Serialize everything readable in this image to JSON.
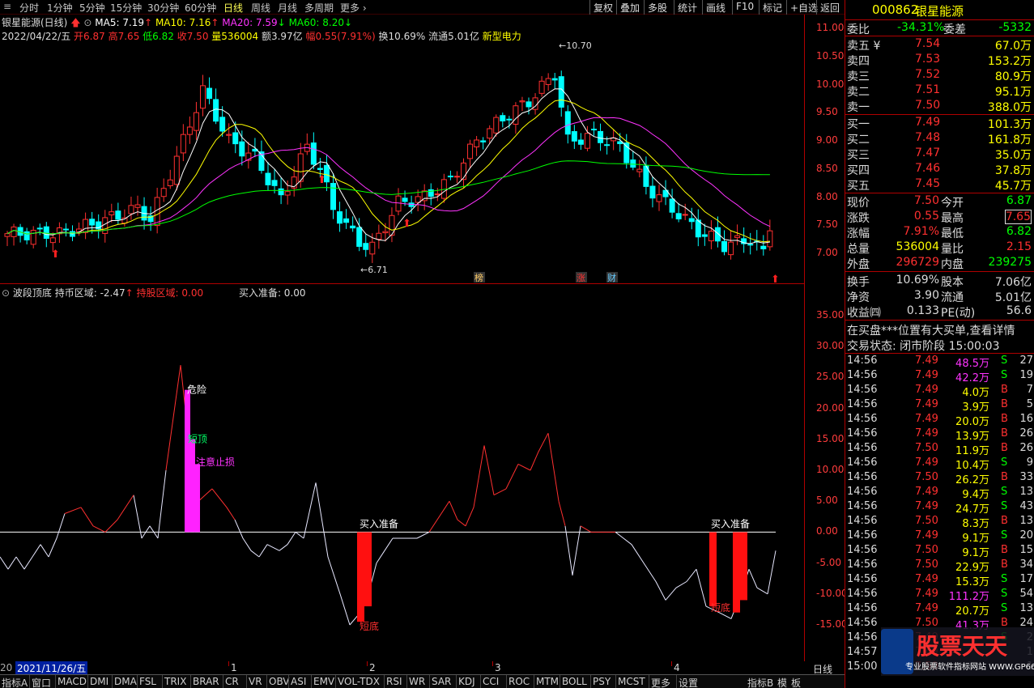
{
  "topbar": {
    "periods": [
      "分时",
      "1分钟",
      "5分钟",
      "15分钟",
      "30分钟",
      "60分钟",
      "日线",
      "周线",
      "月线",
      "多周期",
      "更多 ›"
    ],
    "active_period": "日线",
    "right_buttons": [
      "复权",
      "叠加",
      "多股",
      "统计",
      "画线",
      "F10",
      "标记",
      "+自选",
      "返回"
    ]
  },
  "main": {
    "stock_title": "银星能源(日线)",
    "ma5": "MA5: 7.19",
    "ma10": "MA10: 7.16",
    "ma20": "MA20: 7.59",
    "ma60": "MA60: 8.20",
    "date_info": "2022/04/22/五",
    "open": "开6.87",
    "high": "高7.65",
    "low": "低6.82",
    "close": "收7.50",
    "volume": "量536004",
    "amount": "额3.97亿",
    "change": "幅0.55(7.91%)",
    "turnover": "换10.69%",
    "float": "流通5.01亿",
    "sector": "新型电力",
    "max_label": "10.70",
    "min_label": "6.71",
    "markers": [
      "榜",
      "涨",
      "财"
    ],
    "yticks": [
      "11.00",
      "10.50",
      "10.00",
      "9.50",
      "9.00",
      "8.50",
      "8.00",
      "7.50",
      "7.00"
    ]
  },
  "indicator": {
    "name": "波段顶底",
    "hold_label": "持币区域: -2.47",
    "hold_stock_label": "持股区域: 0.00",
    "buy_ready_label": "买入准备: 0.00",
    "annotations": [
      "危险",
      "短顶",
      "注意止损",
      "买入准备",
      "短底",
      "买入准备",
      "短底"
    ],
    "yticks": [
      "35.00",
      "30.00",
      "25.00",
      "20.00",
      "15.00",
      "10.00",
      "5.00",
      "0.00",
      "-5.00",
      "-10.00",
      "-15.00"
    ]
  },
  "datebar": {
    "left_text": "20",
    "date": "2021/11/26/五",
    "months": [
      "1",
      "2",
      "3",
      "4"
    ],
    "period": "日线"
  },
  "bottombar": {
    "items": [
      "指标A",
      "窗口",
      "MACD",
      "DMI",
      "DMA",
      "FSL",
      "TRIX",
      "BRAR",
      "CR",
      "VR",
      "OBV",
      "ASI",
      "EMV",
      "VOL-TDX",
      "RSI",
      "WR",
      "SAR",
      "KDJ",
      "CCI",
      "ROC",
      "MTM",
      "BOLL",
      "PSY",
      "MCST",
      "更多",
      "设置"
    ],
    "right_items": [
      "指标B",
      "模",
      "板"
    ]
  },
  "quote": {
    "code": "000862",
    "name": "银星能源",
    "weibi_label": "委比",
    "weibi": "-34.31%",
    "weicha_label": "委差",
    "weicha": "-5332",
    "sells": [
      {
        "label": "卖五 ¥",
        "price": "7.54",
        "vol": "67.0万"
      },
      {
        "label": "卖四",
        "price": "7.53",
        "vol": "153.2万"
      },
      {
        "label": "卖三",
        "price": "7.52",
        "vol": "80.9万"
      },
      {
        "label": "卖二",
        "price": "7.51",
        "vol": "95.1万"
      },
      {
        "label": "卖一",
        "price": "7.50",
        "vol": "388.0万"
      }
    ],
    "buys": [
      {
        "label": "买一",
        "price": "7.49",
        "vol": "101.3万"
      },
      {
        "label": "买二",
        "price": "7.48",
        "vol": "161.8万"
      },
      {
        "label": "买三",
        "price": "7.47",
        "vol": "35.0万"
      },
      {
        "label": "买四",
        "price": "7.46",
        "vol": "37.8万"
      },
      {
        "label": "买五",
        "price": "7.45",
        "vol": "45.7万"
      }
    ],
    "stats": [
      {
        "l1": "现价",
        "v1": "7.50",
        "l2": "今开",
        "v2": "6.87"
      },
      {
        "l1": "涨跌",
        "v1": "0.55",
        "l2": "最高",
        "v2": "7.65"
      },
      {
        "l1": "涨幅",
        "v1": "7.91%",
        "l2": "最低",
        "v2": "6.82"
      },
      {
        "l1": "总量",
        "v1": "536004",
        "l2": "量比",
        "v2": "2.15"
      },
      {
        "l1": "外盘",
        "v1": "296729",
        "l2": "内盘",
        "v2": "239275"
      }
    ],
    "stats2": [
      {
        "l1": "换手",
        "v1": "10.69%",
        "l2": "股本",
        "v2": "7.06亿"
      },
      {
        "l1": "净资",
        "v1": "3.90",
        "l2": "流通",
        "v2": "5.01亿"
      },
      {
        "l1": "收益㈣",
        "v1": "0.133",
        "l2": "PE(动)",
        "v2": "56.6"
      }
    ],
    "notice": "在买盘***位置有大买单,查看详情",
    "status": "交易状态: 闭市阶段 15:00:03",
    "ticks": [
      {
        "t": "14:56",
        "p": "7.49",
        "v": "48.5万",
        "d": "S",
        "n": "27"
      },
      {
        "t": "14:56",
        "p": "7.49",
        "v": "42.2万",
        "d": "S",
        "n": "19"
      },
      {
        "t": "14:56",
        "p": "7.49",
        "v": "4.0万",
        "d": "B",
        "n": "7"
      },
      {
        "t": "14:56",
        "p": "7.49",
        "v": "3.9万",
        "d": "B",
        "n": "5"
      },
      {
        "t": "14:56",
        "p": "7.49",
        "v": "20.0万",
        "d": "B",
        "n": "16"
      },
      {
        "t": "14:56",
        "p": "7.49",
        "v": "13.9万",
        "d": "B",
        "n": "26"
      },
      {
        "t": "14:56",
        "p": "7.50",
        "v": "11.9万",
        "d": "B",
        "n": "26"
      },
      {
        "t": "14:56",
        "p": "7.49",
        "v": "10.4万",
        "d": "S",
        "n": "9"
      },
      {
        "t": "14:56",
        "p": "7.50",
        "v": "26.2万",
        "d": "B",
        "n": "33"
      },
      {
        "t": "14:56",
        "p": "7.49",
        "v": "9.4万",
        "d": "S",
        "n": "13"
      },
      {
        "t": "14:56",
        "p": "7.49",
        "v": "24.7万",
        "d": "S",
        "n": "43"
      },
      {
        "t": "14:56",
        "p": "7.50",
        "v": "8.3万",
        "d": "B",
        "n": "13"
      },
      {
        "t": "14:56",
        "p": "7.49",
        "v": "9.1万",
        "d": "S",
        "n": "20"
      },
      {
        "t": "14:56",
        "p": "7.50",
        "v": "9.1万",
        "d": "B",
        "n": "15"
      },
      {
        "t": "14:56",
        "p": "7.50",
        "v": "22.9万",
        "d": "B",
        "n": "34"
      },
      {
        "t": "14:56",
        "p": "7.49",
        "v": "15.3万",
        "d": "S",
        "n": "17"
      },
      {
        "t": "14:56",
        "p": "7.49",
        "v": "111.2万",
        "d": "S",
        "n": "54"
      },
      {
        "t": "14:56",
        "p": "7.49",
        "v": "20.7万",
        "d": "S",
        "n": "13"
      },
      {
        "t": "14:56",
        "p": "7.50",
        "v": "41.3万",
        "d": "B",
        "n": "24"
      },
      {
        "t": "14:56",
        "p": "7.49",
        "v": "",
        "d": "S",
        "n": "2"
      },
      {
        "t": "14:57",
        "p": "7.49",
        "v": "",
        "d": "",
        "n": "1"
      },
      {
        "t": "15:00",
        "p": "7.50",
        "v": "",
        "d": "",
        "n": "1"
      }
    ]
  },
  "watermark": {
    "brand": "股票天天",
    "url": "专业股票软件指标网站 WWW.GP66.CN"
  }
}
